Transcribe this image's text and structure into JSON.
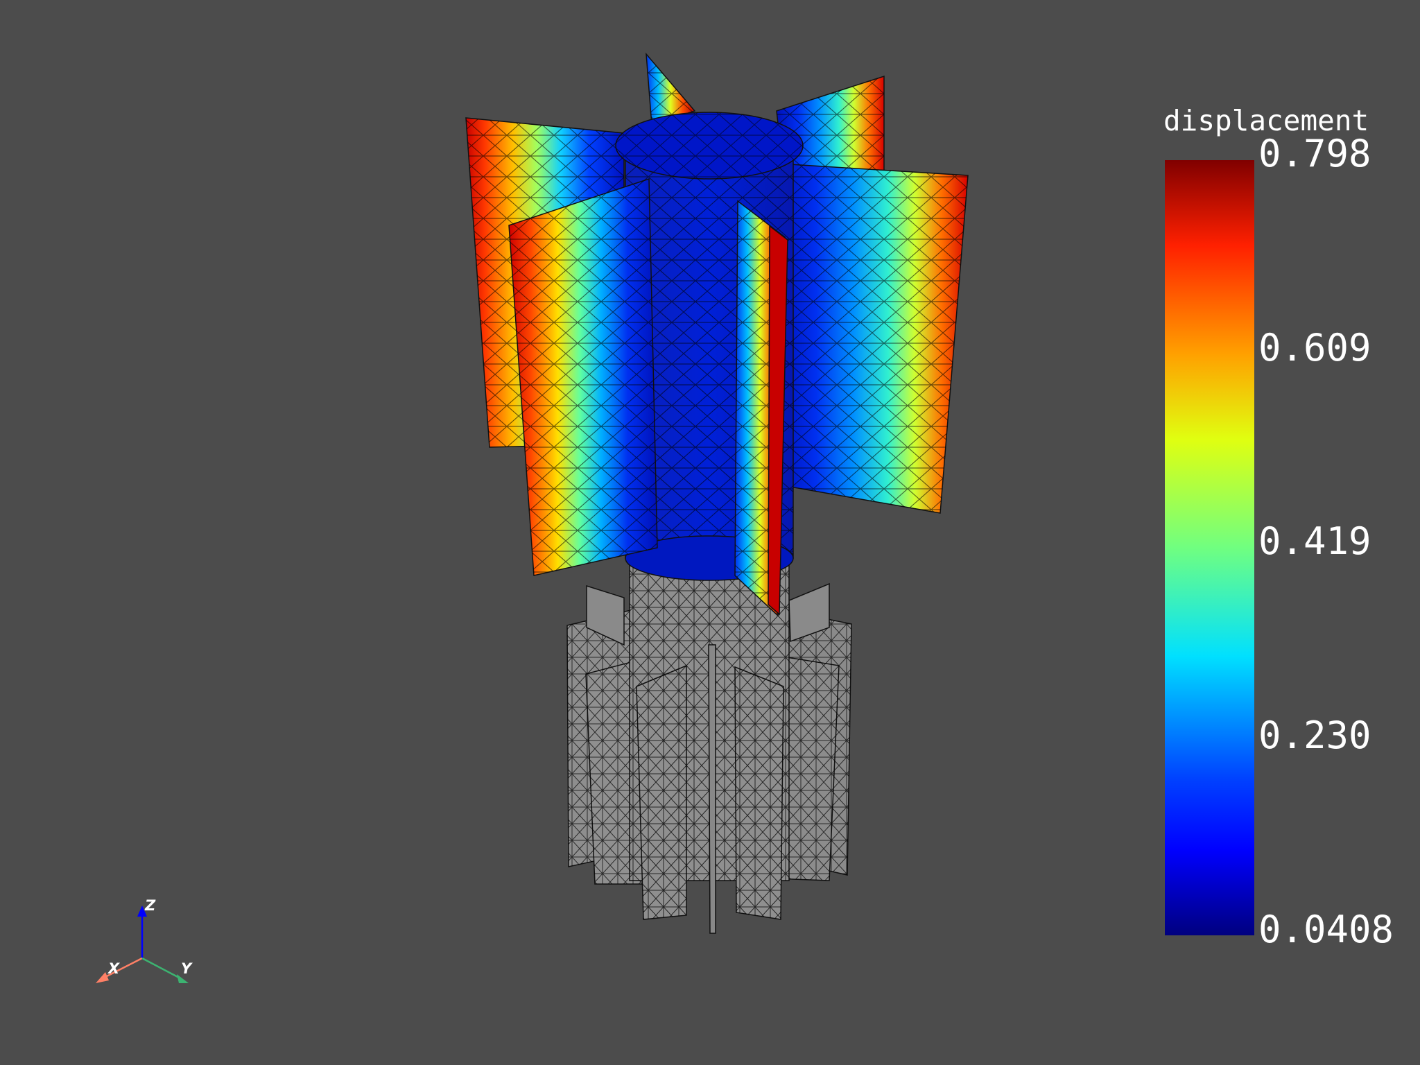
{
  "scene": {
    "background": "#4c4c4c",
    "model": "finned-cylinder-mesh",
    "deformed_surface": "colored-by-displacement",
    "undeformed_surface_color": "#8c8c8c",
    "mesh_edges_color": "#000000"
  },
  "scalar_bar": {
    "title": "displacement",
    "labels": [
      "0.798",
      "0.609",
      "0.419",
      "0.230",
      "0.0408"
    ],
    "colormap": "jet"
  },
  "axes": {
    "x": {
      "label": "X",
      "color": "#ff8066"
    },
    "y": {
      "label": "Y",
      "color": "#3cb371"
    },
    "z": {
      "label": "Z",
      "color": "#0000ff"
    }
  }
}
